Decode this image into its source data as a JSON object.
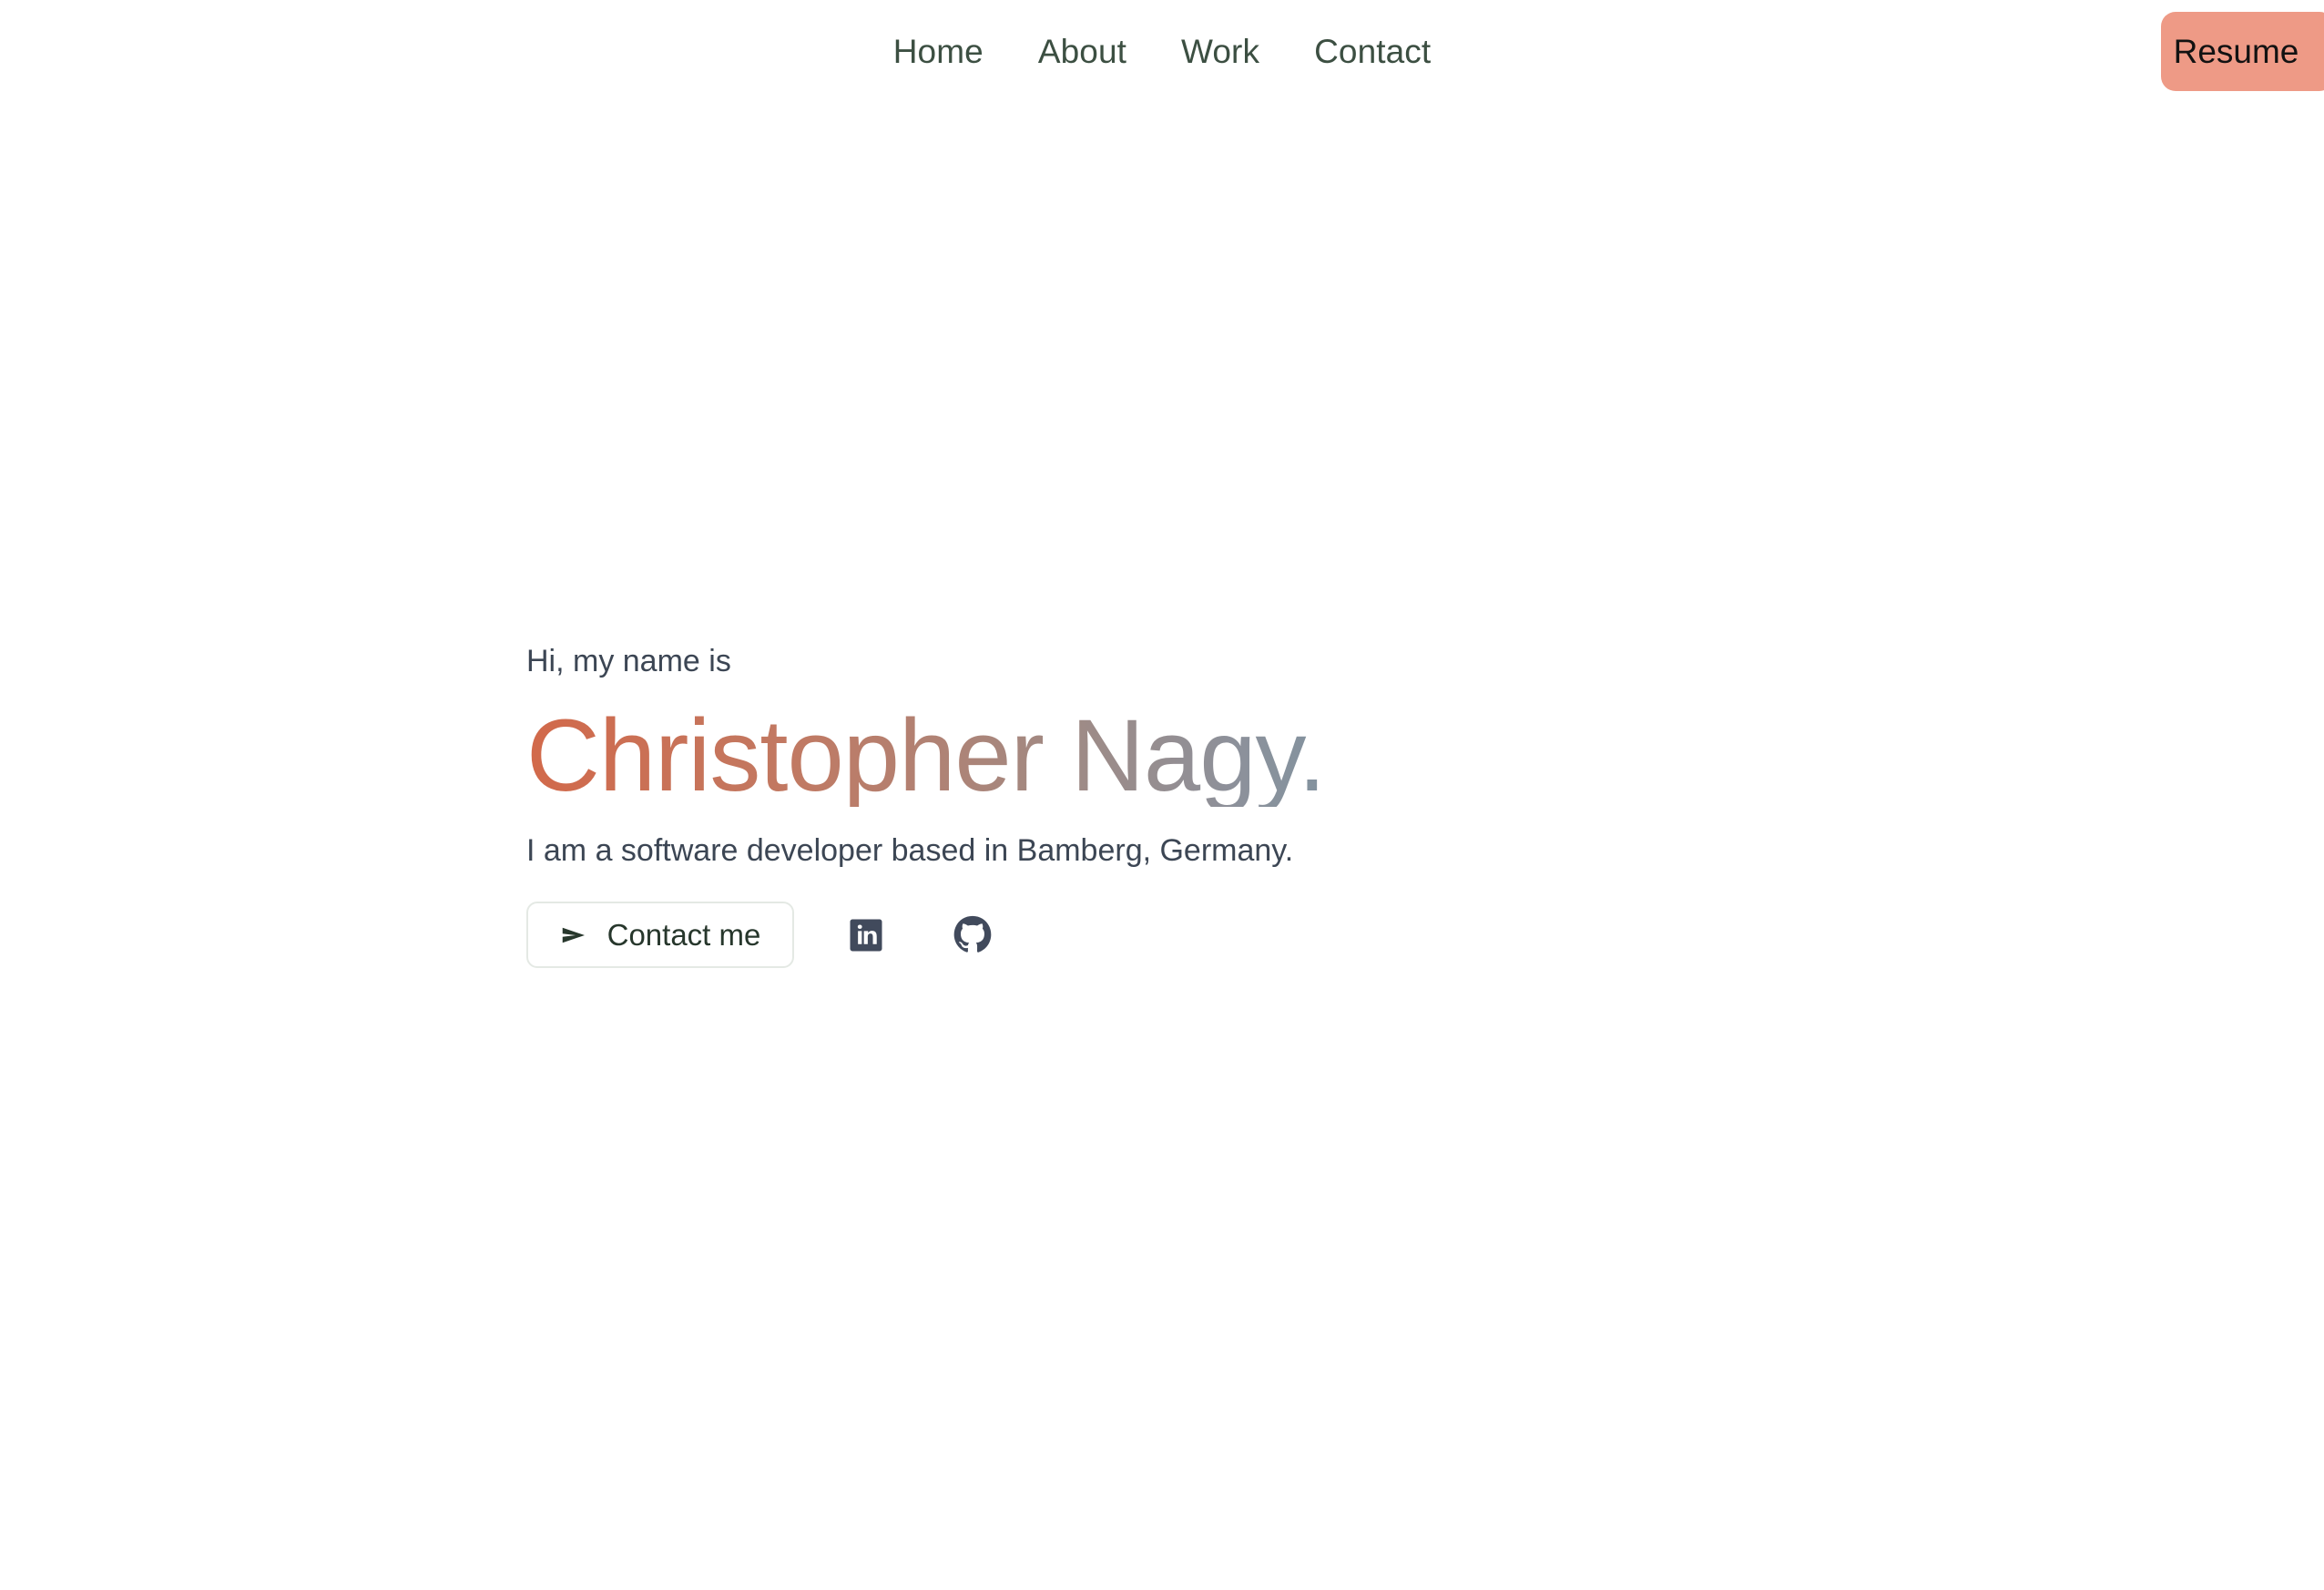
{
  "site": {
    "owner": "Christopher Nagy",
    "background_color": "#ffffff"
  },
  "navbar": {
    "links": [
      {
        "label": "Home",
        "name": "nav-link-home"
      },
      {
        "label": "About",
        "name": "nav-link-about"
      },
      {
        "label": "Work",
        "name": "nav-link-work"
      },
      {
        "label": "Contact",
        "name": "nav-link-contact"
      }
    ],
    "link_color": "#3c4f42",
    "resume_button": {
      "label": "Resume",
      "background_color": "#ee9a86",
      "text_color": "#121212"
    }
  },
  "hero": {
    "greeting": "Hi, my name is",
    "name": "Christopher Nagy.",
    "name_gradient_start": "#d2694a",
    "name_gradient_end": "#5d92a3",
    "subtitle": "I am a software developer based in Bamberg, Germany.",
    "text_color": "#3c4654",
    "contact_button": {
      "label": "Contact me",
      "icon": "send-icon",
      "text_color": "#27372c",
      "border_color": "#e4e9e4",
      "background_color": "#ffffff"
    },
    "socials": [
      {
        "icon": "linkedin-icon",
        "name": "social-link-linkedin"
      },
      {
        "icon": "github-icon",
        "name": "social-link-github"
      }
    ],
    "social_color": "#414a5c"
  }
}
